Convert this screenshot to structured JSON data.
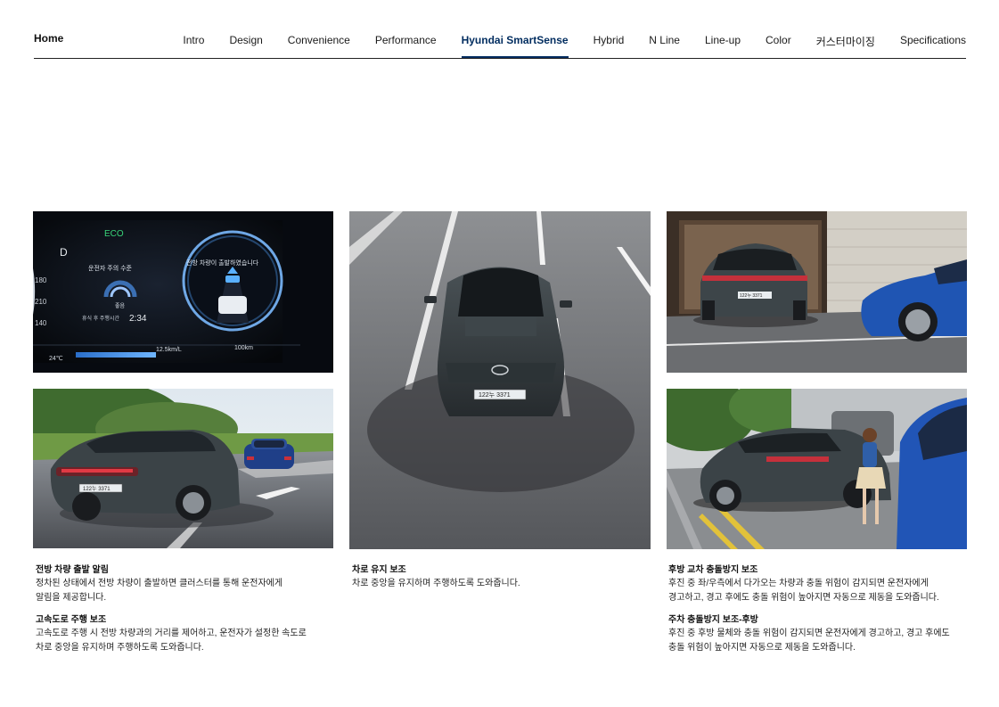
{
  "nav": {
    "home_label": "Home",
    "tabs": [
      {
        "label": "Intro"
      },
      {
        "label": "Design"
      },
      {
        "label": "Convenience"
      },
      {
        "label": "Performance"
      },
      {
        "label": "Hyundai SmartSense"
      },
      {
        "label": "Hybrid"
      },
      {
        "label": "N Line"
      },
      {
        "label": "Line-up"
      },
      {
        "label": "Color"
      },
      {
        "label": "커스터마이징"
      },
      {
        "label": "Specifications"
      }
    ],
    "active_tab": "Hyundai SmartSense"
  },
  "images": {
    "cluster": {
      "eco_label": "ECO",
      "gear": "D",
      "left_title": "운전자 주의 수준",
      "level_label": "좋음",
      "rest_label": "휴식 후 주행시간",
      "rest_time": "2:34",
      "right_message": "전방 차량이 출발하였습니다",
      "temperature": "24℃",
      "economy": "12.5km/L",
      "range": "100km",
      "speed_ticks": [
        "180",
        "210",
        "140"
      ]
    },
    "plate": "122누 3371"
  },
  "captions": {
    "col1": [
      {
        "title": "전방 차량 출발 알림",
        "desc": "정차된 상태에서 전방 차량이 출발하면 클러스터를 통해 운전자에게\n알림을 제공합니다."
      },
      {
        "title": "고속도로 주행 보조",
        "desc": "고속도로 주행 시 전방 차량과의 거리를 제어하고, 운전자가 설정한 속도로\n차로 중앙을 유지하며 주행하도록 도와줍니다."
      }
    ],
    "col2": [
      {
        "title": "차로 유지 보조",
        "desc": "차로 중앙을 유지하며 주행하도록 도와줍니다."
      }
    ],
    "col3": [
      {
        "title": "후방 교차 충돌방지 보조",
        "desc": "후진 중 좌/우측에서 다가오는 차량과 충돌 위험이 감지되면 운전자에게\n경고하고, 경고 후에도 충돌 위험이 높아지면 자동으로 제동을 도와줍니다."
      },
      {
        "title": "주차 충돌방지 보조-후방",
        "desc": "후진 중 후방 물체와 충돌 위험이 감지되면 운전자에게 경고하고, 경고 후에도\n충돌 위험이 높아지면 자동으로 제동을 도와줍니다."
      }
    ]
  },
  "colors": {
    "accent": "#002c5f",
    "divider": "#222222",
    "car_body": "#3c4448",
    "blue_car": "#1f4fa8"
  }
}
